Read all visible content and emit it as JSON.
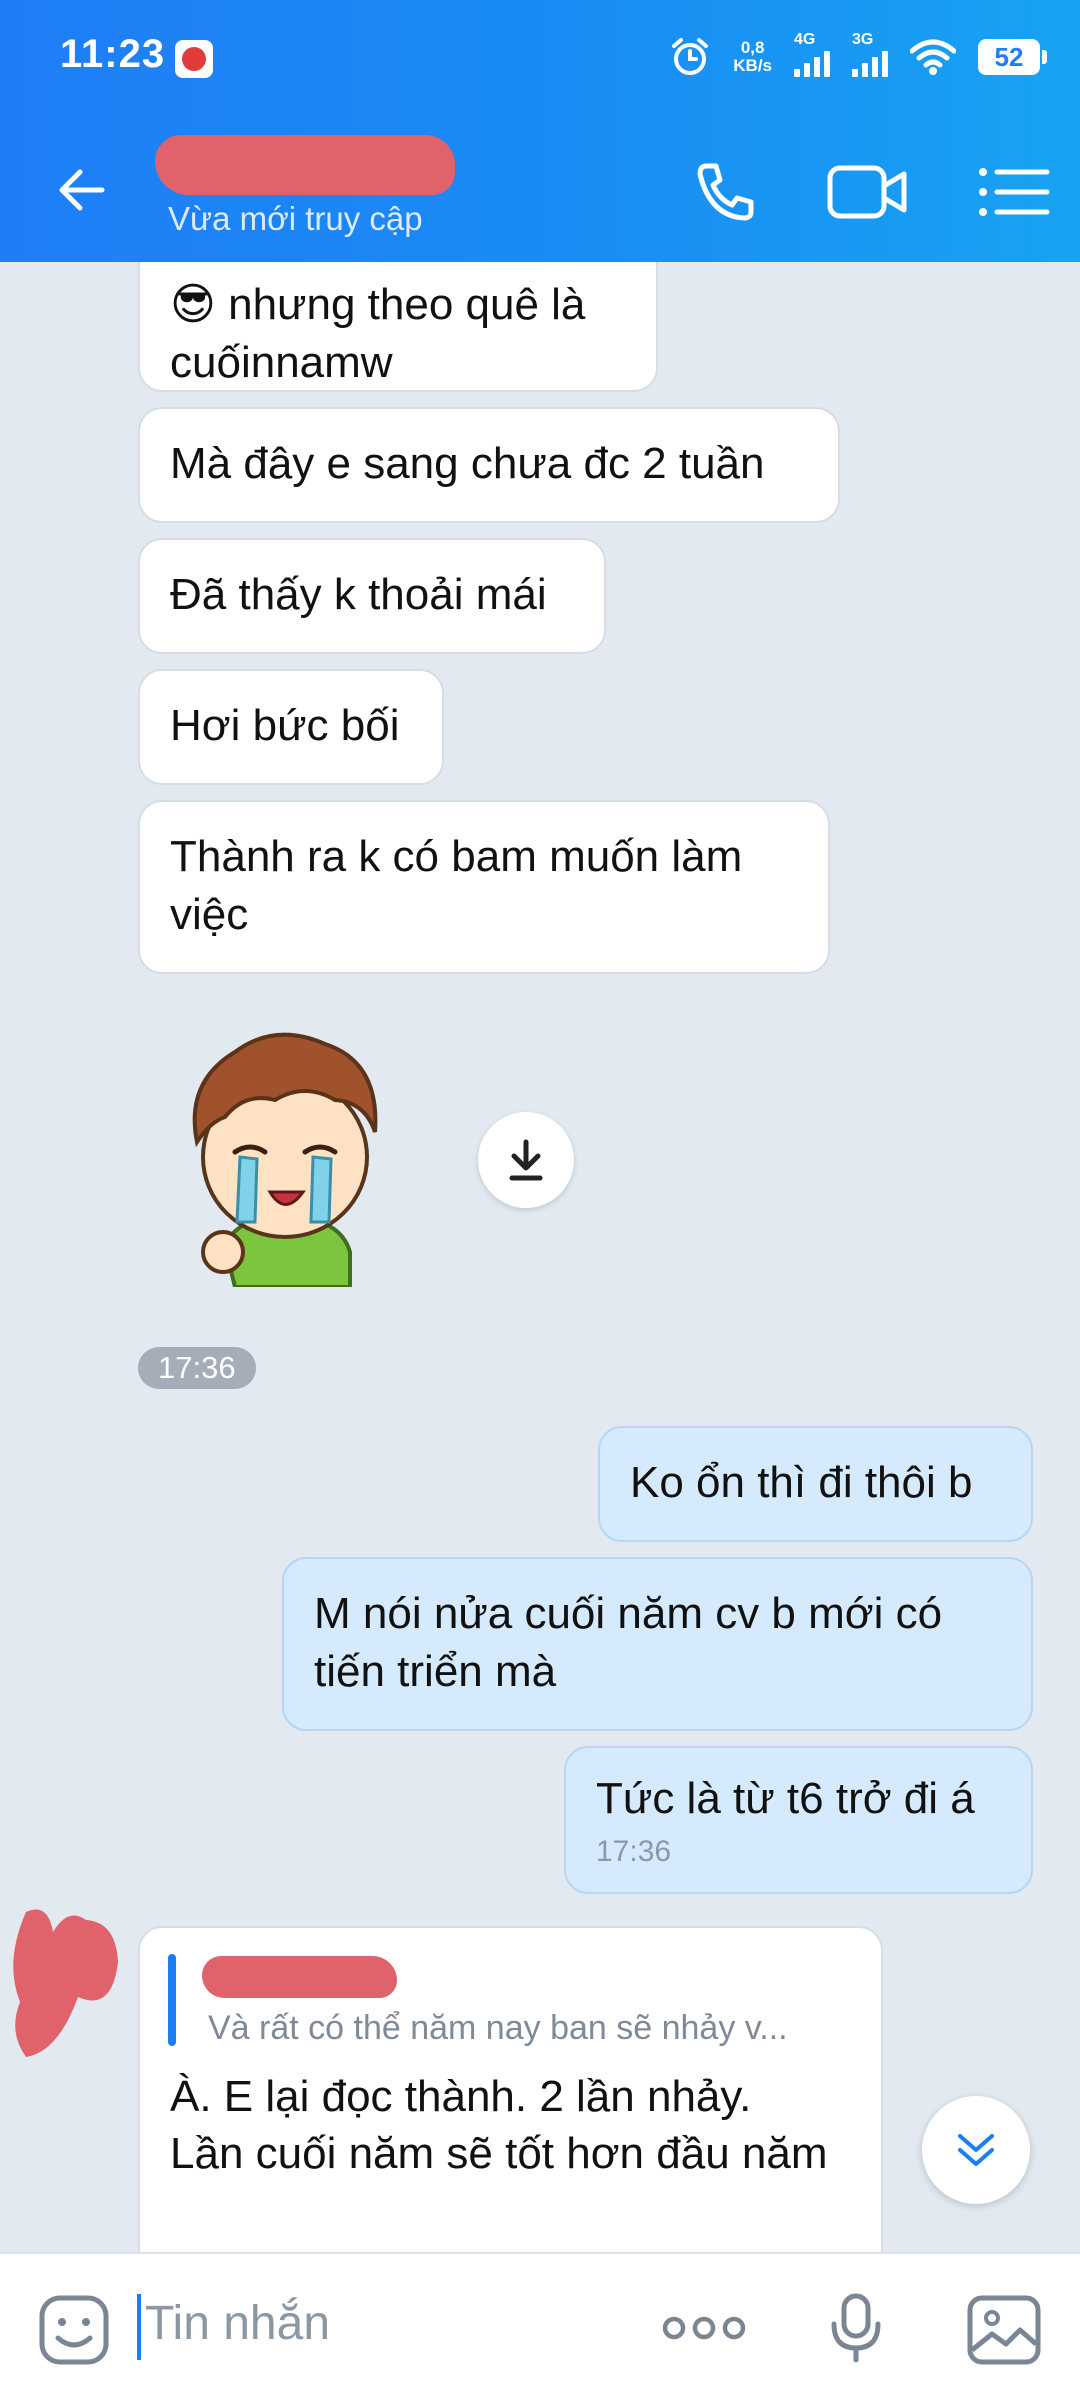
{
  "status_bar": {
    "time": "11:23",
    "net_speed_top": "0,8",
    "net_speed_bottom": "KB/s",
    "sig1_label": "4G",
    "sig2_label": "3G",
    "battery": "52"
  },
  "header": {
    "subtitle": "Vừa mới truy cập"
  },
  "messages": [
    {
      "dir": "received",
      "text": "😎 nhưng theo quê là cuốinnamw"
    },
    {
      "dir": "received",
      "text": "Mà đây e sang chưa đc 2 tuần"
    },
    {
      "dir": "received",
      "text": "Đã thấy k thoải mái"
    },
    {
      "dir": "received",
      "text": "Hơi bức bối"
    },
    {
      "dir": "received",
      "text": "Thành ra k có bam muốn làm việc"
    },
    {
      "dir": "sent",
      "text": "Ko ổn thì đi thôi b"
    },
    {
      "dir": "sent",
      "text": "M nói nửa cuối năm cv b mới có tiến triển mà"
    },
    {
      "dir": "sent",
      "text": "Tức là từ t6 trở đi á",
      "time": "17:36"
    },
    {
      "dir": "received",
      "quote": "Và rất có thể năm nay ban sẽ nhảy v...",
      "text": "À. E lại đọc thành. 2 lần nhảy. Lần cuối năm sẽ tốt hơn đầu năm"
    }
  ],
  "time_divider": "17:36",
  "input": {
    "placeholder": "Tin nhắn"
  },
  "colors": {
    "header": "#1f7ef6",
    "chat_bg": "#e2e9f1",
    "sent_bubble": "#d5ebfd",
    "received_bubble": "#ffffff",
    "accent": "#1a7ff5"
  }
}
